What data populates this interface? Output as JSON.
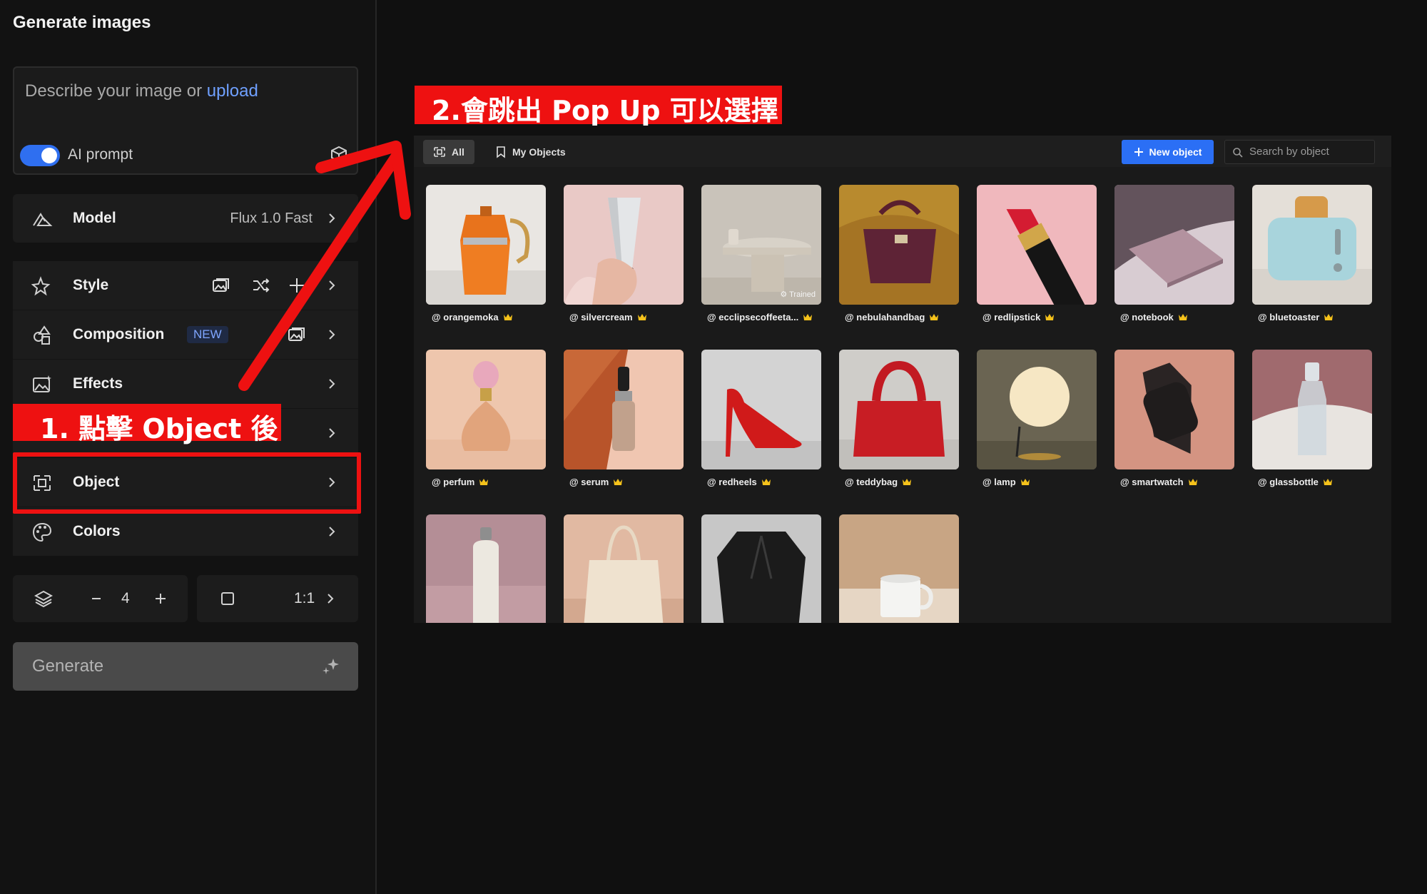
{
  "sidebar": {
    "title": "Generate images",
    "prompt": {
      "placeholder": "Describe your image or",
      "upload_link": "upload",
      "ai_prompt_label": "AI prompt"
    },
    "model": {
      "label": "Model",
      "value": "Flux 1.0 Fast"
    },
    "style": {
      "label": "Style"
    },
    "composition": {
      "label": "Composition",
      "badge": "NEW"
    },
    "effects": {
      "label": "Effects"
    },
    "object": {
      "label": "Object"
    },
    "colors": {
      "label": "Colors"
    },
    "count": {
      "value": "4"
    },
    "ratio": {
      "value": "1:1"
    },
    "generate_label": "Generate"
  },
  "annotations": {
    "step1": "1. 點擊 Object 後",
    "step2": "2.會跳出 Pop Up 可以選擇"
  },
  "popup": {
    "tabs": [
      {
        "label": "All"
      },
      {
        "label": "My Objects"
      }
    ],
    "new_object_label": "New object",
    "search_placeholder": "Search by object",
    "objects": [
      {
        "name": "@ orangemoka",
        "icon": "moka-pot"
      },
      {
        "name": "@ silvercream",
        "icon": "tube"
      },
      {
        "name": "@ ecclipsecoffeeta...",
        "icon": "side-table",
        "trained_label": "Trained"
      },
      {
        "name": "@ nebulahandbag",
        "icon": "handbag"
      },
      {
        "name": "@ redlipstick",
        "icon": "lipstick"
      },
      {
        "name": "@ notebook",
        "icon": "notebook"
      },
      {
        "name": "@ bluetoaster",
        "icon": "toaster"
      },
      {
        "name": "@ perfum",
        "icon": "perfume"
      },
      {
        "name": "@ serum",
        "icon": "serum"
      },
      {
        "name": "@ redheels",
        "icon": "heels"
      },
      {
        "name": "@ teddybag",
        "icon": "bag"
      },
      {
        "name": "@ lamp",
        "icon": "lamp"
      },
      {
        "name": "@ smartwatch",
        "icon": "watch"
      },
      {
        "name": "@ glassbottle",
        "icon": "bottle"
      },
      {
        "name": "",
        "icon": "thermos"
      },
      {
        "name": "",
        "icon": "tote"
      },
      {
        "name": "",
        "icon": "jacket"
      },
      {
        "name": "",
        "icon": "mug"
      }
    ]
  },
  "colors": {
    "accent": "#2b6ff5",
    "annotation": "#ee1111",
    "crown": "#f5c21b"
  }
}
